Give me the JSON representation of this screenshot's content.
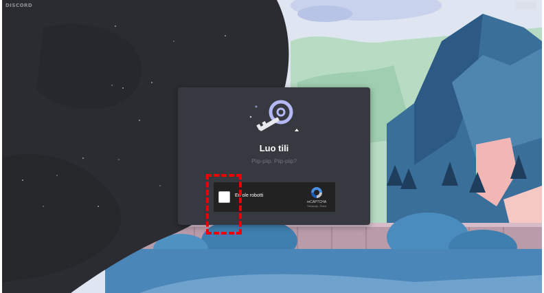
{
  "window": {
    "app_name": "DISCORD"
  },
  "modal": {
    "title": "Luo tili",
    "subtitle": "Piip-piip. Piip-piip?"
  },
  "captcha": {
    "label": "En ole robotti",
    "brand": "reCAPTCHA",
    "links": "Tietosuoja - Ehdot",
    "checked": false
  },
  "icons": {
    "key": "key-icon",
    "recaptcha": "recaptcha-logo-icon"
  },
  "colors": {
    "modal_bg": "#36393f",
    "annotation": "#ee0000",
    "left_panel": "#2b2c31"
  }
}
